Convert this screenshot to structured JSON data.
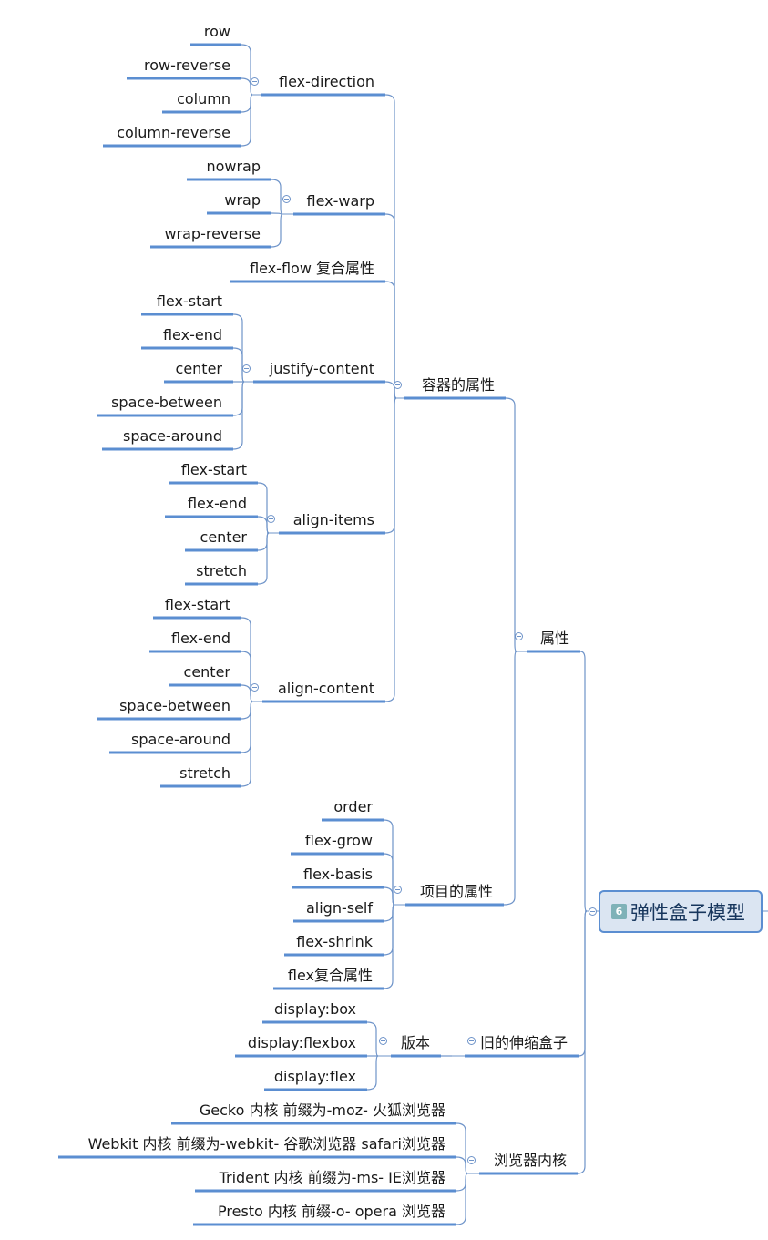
{
  "colors": {
    "line": "#5b8ed1",
    "thin_line": "#6f94c9",
    "root_bg": "#dbe5f2",
    "root_border": "#5b8ed1",
    "badge": "#7fb2b8",
    "text": "#1a1a1a",
    "root_text": "#17365d"
  },
  "root": {
    "badge": "6",
    "badge_icon": "priority-6-icon",
    "title": "弹性盒子模型"
  },
  "tree": {
    "label": "弹性盒子模型",
    "children": [
      {
        "label": "属性",
        "children": [
          {
            "label": "容器的属性",
            "children": [
              {
                "label": "flex-direction",
                "children": [
                  {
                    "label": "row"
                  },
                  {
                    "label": "row-reverse"
                  },
                  {
                    "label": "column"
                  },
                  {
                    "label": "column-reverse"
                  }
                ]
              },
              {
                "label": "flex-warp",
                "children": [
                  {
                    "label": "nowrap"
                  },
                  {
                    "label": "wrap"
                  },
                  {
                    "label": "wrap-reverse"
                  }
                ]
              },
              {
                "label": "flex-flow 复合属性"
              },
              {
                "label": "justify-content",
                "children": [
                  {
                    "label": "flex-start"
                  },
                  {
                    "label": "flex-end"
                  },
                  {
                    "label": "center"
                  },
                  {
                    "label": "space-between"
                  },
                  {
                    "label": "space-around"
                  }
                ]
              },
              {
                "label": "align-items",
                "children": [
                  {
                    "label": "flex-start"
                  },
                  {
                    "label": "flex-end"
                  },
                  {
                    "label": "center"
                  },
                  {
                    "label": "stretch"
                  }
                ]
              },
              {
                "label": "align-content",
                "children": [
                  {
                    "label": "flex-start"
                  },
                  {
                    "label": "flex-end"
                  },
                  {
                    "label": "center"
                  },
                  {
                    "label": "space-between"
                  },
                  {
                    "label": "space-around"
                  },
                  {
                    "label": "stretch"
                  }
                ]
              }
            ]
          },
          {
            "label": "项目的属性",
            "children": [
              {
                "label": "order"
              },
              {
                "label": "flex-grow"
              },
              {
                "label": "flex-basis"
              },
              {
                "label": "align-self"
              },
              {
                "label": "flex-shrink"
              },
              {
                "label": "flex复合属性"
              }
            ]
          }
        ]
      },
      {
        "label": "旧的伸缩盒子",
        "children": [
          {
            "label": "版本",
            "children": [
              {
                "label": "display:box"
              },
              {
                "label": "display:flexbox"
              },
              {
                "label": "display:flex"
              }
            ]
          }
        ]
      },
      {
        "label": "浏览器内核",
        "children": [
          {
            "label": "Gecko  内核 前缀为-moz- 火狐浏览器"
          },
          {
            "label": "Webkit  内核 前缀为-webkit- 谷歌浏览器 safari浏览器"
          },
          {
            "label": "Trident  内核 前缀为-ms- IE浏览器"
          },
          {
            "label": "Presto  内核 前缀-o- opera 浏览器"
          }
        ]
      }
    ]
  }
}
